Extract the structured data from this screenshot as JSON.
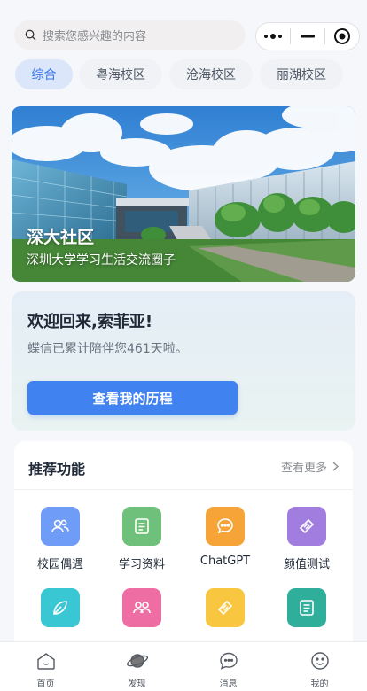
{
  "search": {
    "placeholder": "搜索您感兴趣的内容",
    "icon": "search-icon"
  },
  "capsule": {
    "more_icon": "more-dots-icon",
    "minimize_icon": "minimize-icon",
    "close_icon": "target-close-icon"
  },
  "tabs": [
    {
      "label": "综合",
      "active": true
    },
    {
      "label": "粤海校区",
      "active": false
    },
    {
      "label": "沧海校区",
      "active": false
    },
    {
      "label": "丽湖校区",
      "active": false
    }
  ],
  "banner": {
    "title": "深大社区",
    "subtitle": "深圳大学学习生活交流圈子"
  },
  "welcome": {
    "title": "欢迎回来,索菲亚!",
    "subtitle": "蝶信已累计陪伴您461天啦。",
    "button": "查看我的历程"
  },
  "recommend": {
    "title": "推荐功能",
    "more": "查看更多",
    "items": [
      {
        "label": "校园偶遇",
        "icon": "people-icon",
        "color": "#6f9cf6"
      },
      {
        "label": "学习资料",
        "icon": "document-icon",
        "color": "#6fc07a"
      },
      {
        "label": "ChatGPT",
        "icon": "chat-bubble-icon",
        "color": "#f6a438"
      },
      {
        "label": "颜值测试",
        "icon": "ticket-icon",
        "color": "#a27de0"
      },
      {
        "label": "",
        "icon": "leaf-icon",
        "color": "#38c7d3"
      },
      {
        "label": "",
        "icon": "group-icon",
        "color": "#ee6ea4"
      },
      {
        "label": "",
        "icon": "ticket-icon",
        "color": "#f9c63f"
      },
      {
        "label": "",
        "icon": "document-icon",
        "color": "#2fae9c"
      }
    ]
  },
  "bottom_nav": [
    {
      "label": "首页",
      "icon": "home-icon"
    },
    {
      "label": "发现",
      "icon": "planet-icon"
    },
    {
      "label": "消息",
      "icon": "message-icon"
    },
    {
      "label": "我的",
      "icon": "smile-icon"
    }
  ],
  "colors": {
    "accent": "#3f82f0",
    "tab_active_bg": "#dbe6fb",
    "tab_active_text": "#3b78e7"
  }
}
